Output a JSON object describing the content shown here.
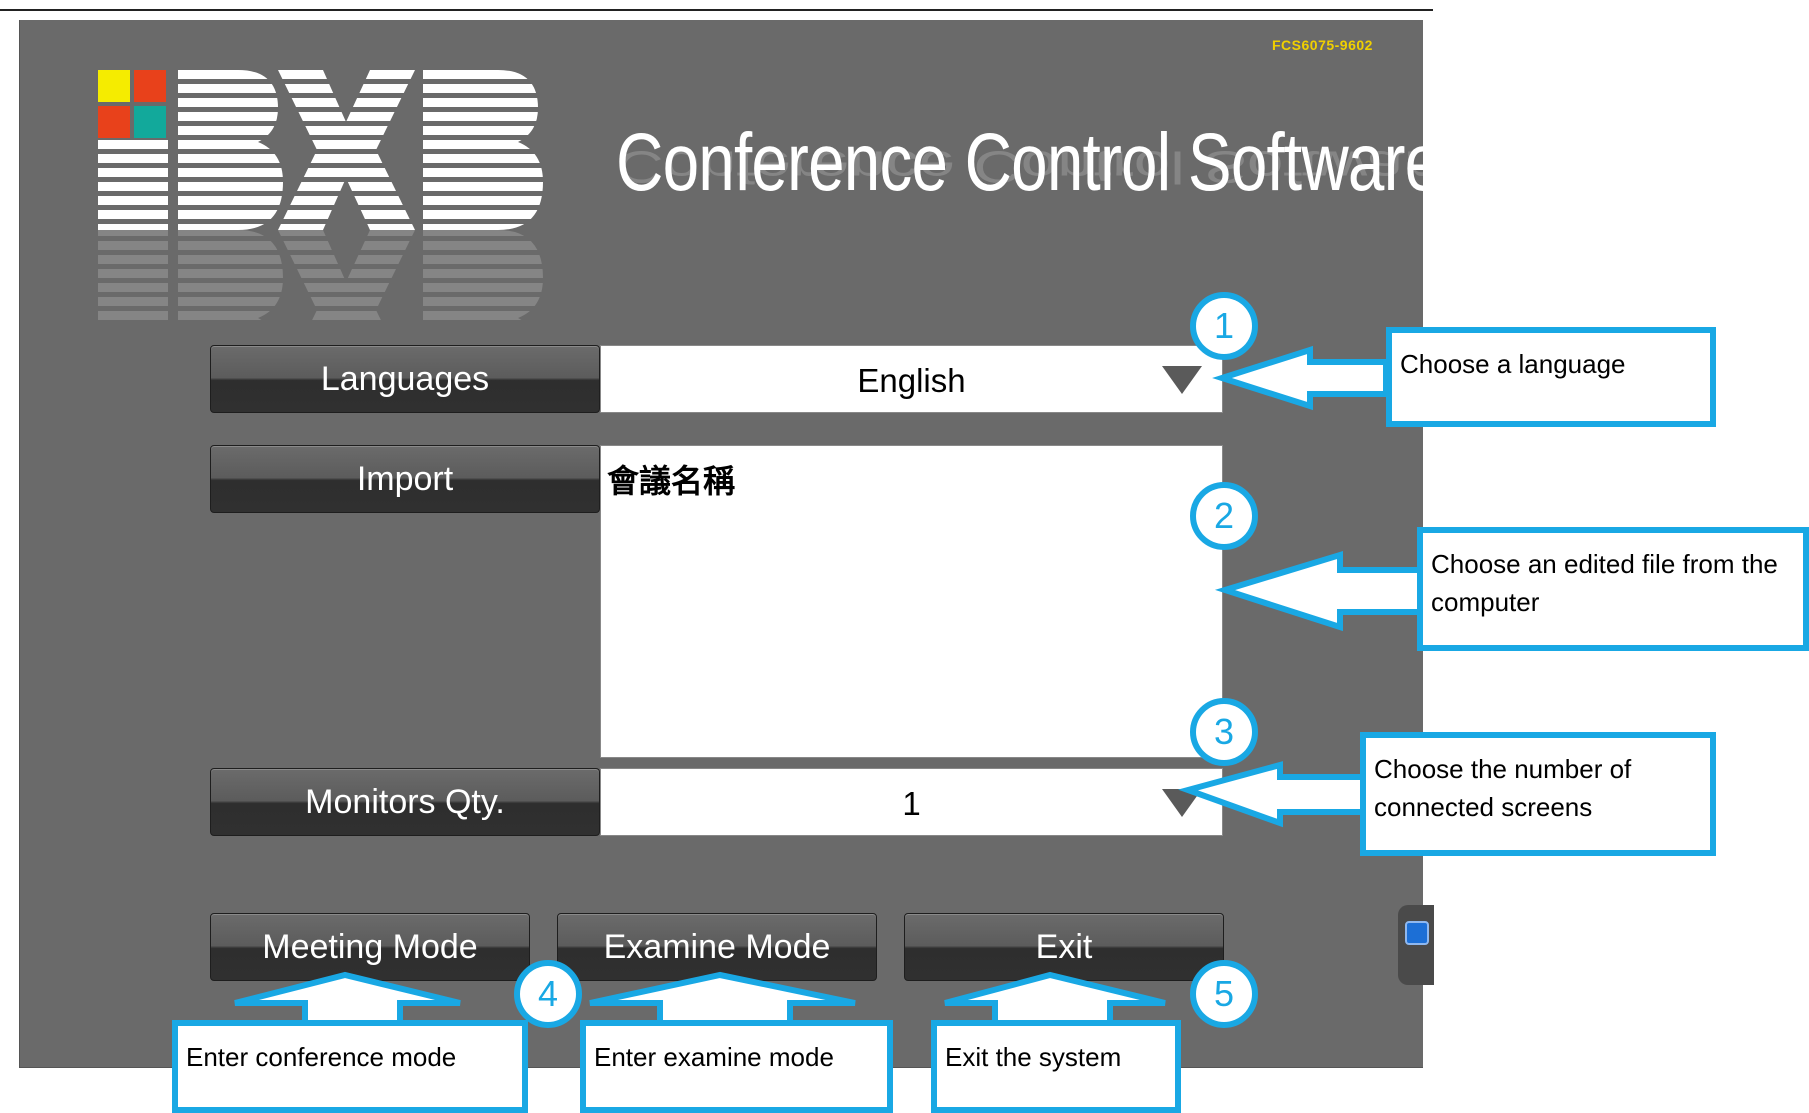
{
  "app": {
    "serial": "FCS6075-9602",
    "title": "Conference Control Software",
    "logo_colors": [
      "#f5ec00",
      "#e8411b",
      "#e8411b",
      "#12a99b"
    ]
  },
  "form": {
    "languages_label": "Languages",
    "languages_value": "English",
    "import_label": "Import",
    "import_file_name": "會議名稱",
    "monitors_label": "Monitors Qty.",
    "monitors_value": "1"
  },
  "actions": {
    "meeting_mode": "Meeting Mode",
    "examine_mode": "Examine Mode",
    "exit": "Exit"
  },
  "annotations": [
    {
      "number": "1",
      "text": "Choose a language"
    },
    {
      "number": "2",
      "text": "Choose an edited file from the computer"
    },
    {
      "number": "3",
      "text": "Choose the number of connected screens"
    },
    {
      "number": "4",
      "text": "Enter conference mode"
    },
    {
      "number": "5",
      "text": "Enter examine mode"
    },
    {
      "number": "",
      "text": "Exit the system"
    }
  ],
  "colors": {
    "accent": "#19a8e4",
    "background": "#6a6a6a",
    "serial": "#f0d000"
  }
}
